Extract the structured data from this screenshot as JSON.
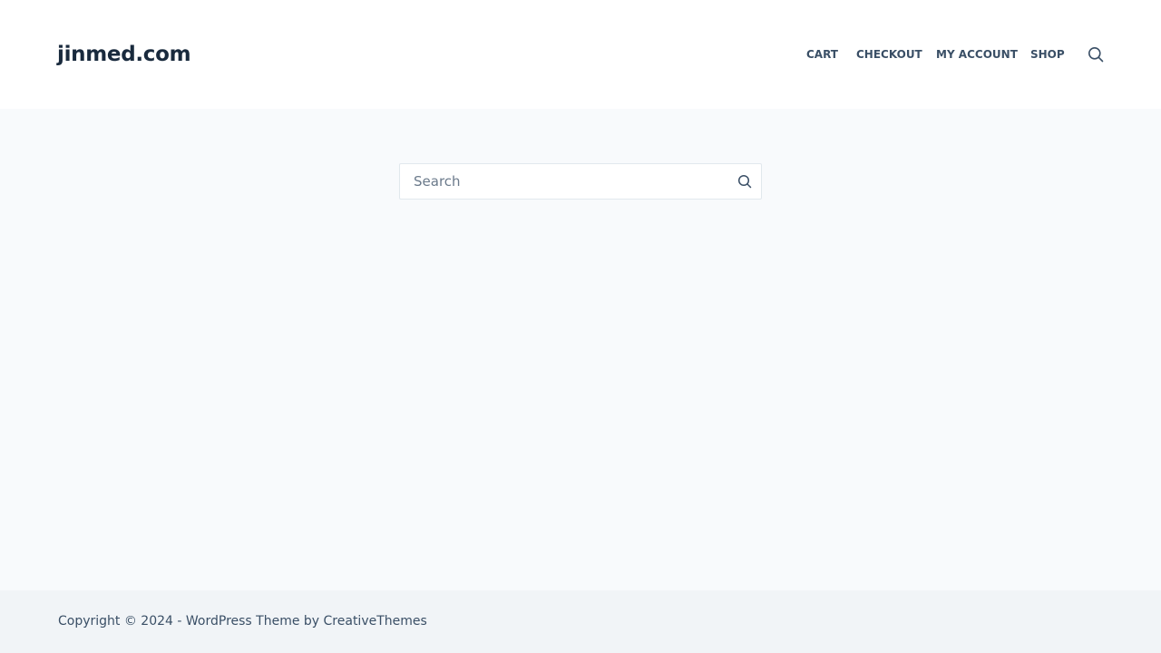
{
  "header": {
    "logo_text": "jinmed.com",
    "nav": [
      {
        "label": "CART"
      },
      {
        "label": "CHECKOUT"
      },
      {
        "label": "MY ACCOUNT"
      },
      {
        "label": "SHOP"
      }
    ],
    "search_icon": "search-icon"
  },
  "main": {
    "search": {
      "placeholder": "Search",
      "value": "",
      "submit_icon": "search-icon"
    }
  },
  "footer": {
    "copyright_prefix": "Copyright © 2024 - WordPress Theme by ",
    "copyright_link": "CreativeThemes"
  },
  "colors": {
    "header_bg": "#ffffff",
    "page_bg": "#f8fafc",
    "footer_bg": "#f1f4f7",
    "logo": "#192a3d",
    "nav_text": "#3a4f66",
    "input_border": "#e1e8ed"
  }
}
